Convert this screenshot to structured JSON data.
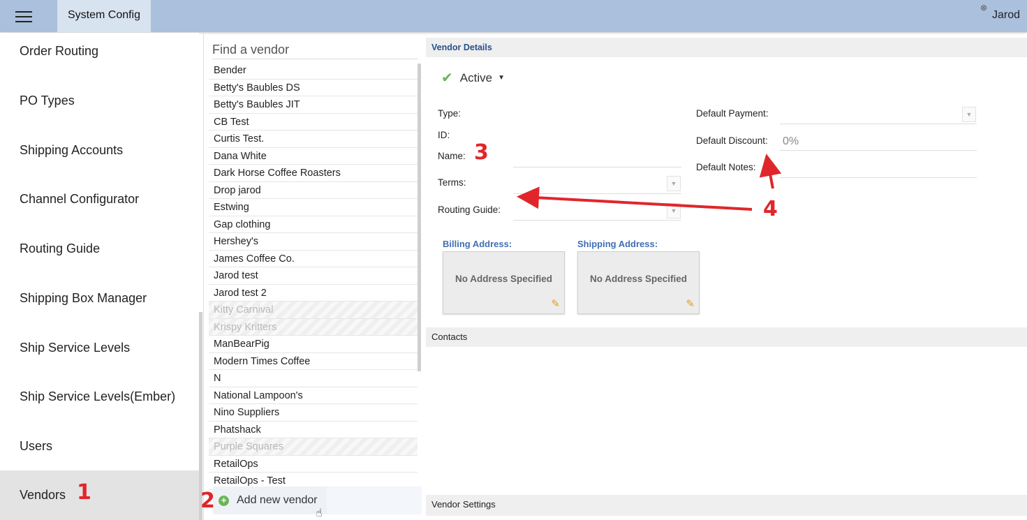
{
  "topbar": {
    "title": "System Config",
    "user": "Jarod",
    "close_glyph": "⊗"
  },
  "sidebar": {
    "items": [
      {
        "label": "Order Routing"
      },
      {
        "label": "PO Types"
      },
      {
        "label": "Shipping Accounts"
      },
      {
        "label": "Channel Configurator"
      },
      {
        "label": "Routing Guide"
      },
      {
        "label": "Shipping Box Manager"
      },
      {
        "label": "Ship Service Levels"
      },
      {
        "label": "Ship Service Levels(Ember)"
      },
      {
        "label": "Users"
      },
      {
        "label": "Vendors",
        "active": true
      }
    ]
  },
  "vendors": {
    "search_placeholder": "Find a vendor",
    "list": [
      {
        "name": "Bender",
        "active": true
      },
      {
        "name": "Betty's Baubles DS",
        "active": true
      },
      {
        "name": "Betty's Baubles JIT",
        "active": true
      },
      {
        "name": "CB Test",
        "active": true
      },
      {
        "name": "Curtis Test.",
        "active": true
      },
      {
        "name": "Dana White",
        "active": true
      },
      {
        "name": "Dark Horse Coffee Roasters",
        "active": true
      },
      {
        "name": "Drop jarod",
        "active": true
      },
      {
        "name": "Estwing",
        "active": true
      },
      {
        "name": "Gap clothing",
        "active": true
      },
      {
        "name": "Hershey's",
        "active": true
      },
      {
        "name": "James Coffee Co.",
        "active": true
      },
      {
        "name": "Jarod test",
        "active": true
      },
      {
        "name": "Jarod test 2",
        "active": true
      },
      {
        "name": "Kitty Carnival",
        "active": false
      },
      {
        "name": "Krispy Kritters",
        "active": false
      },
      {
        "name": "ManBearPig",
        "active": true
      },
      {
        "name": "Modern Times Coffee",
        "active": true
      },
      {
        "name": "N",
        "active": true
      },
      {
        "name": "National Lampoon's",
        "active": true
      },
      {
        "name": "Nino Suppliers",
        "active": true
      },
      {
        "name": "Phatshack",
        "active": true
      },
      {
        "name": "Purple Squares",
        "active": false
      },
      {
        "name": "RetailOps",
        "active": true
      },
      {
        "name": "RetailOps - Test",
        "active": true
      }
    ],
    "add_label": "Add new vendor"
  },
  "details": {
    "section_title": "Vendor Details",
    "status": "Active",
    "labels": {
      "type": "Type:",
      "id": "ID:",
      "name": "Name:",
      "terms": "Terms:",
      "routing_guide": "Routing Guide:",
      "default_payment": "Default Payment:",
      "default_discount": "Default Discount:",
      "default_notes": "Default Notes:"
    },
    "default_discount_value": "0%",
    "billing_label": "Billing Address:",
    "shipping_label": "Shipping Address:",
    "no_address": "No Address Specified"
  },
  "contacts_title": "Contacts",
  "vendor_settings_title": "Vendor Settings",
  "annotations": {
    "a1": "1",
    "a2": "2",
    "a3": "3",
    "a4": "4",
    "color": "#e0262b"
  },
  "icons": {
    "menu": "hamburger-icon",
    "close": "close-circle-icon",
    "check": "checkmark-icon",
    "caret": "caret-down-icon",
    "add": "plus-circle-icon",
    "edit": "pencil-icon",
    "cursor": "hand-cursor-icon"
  }
}
